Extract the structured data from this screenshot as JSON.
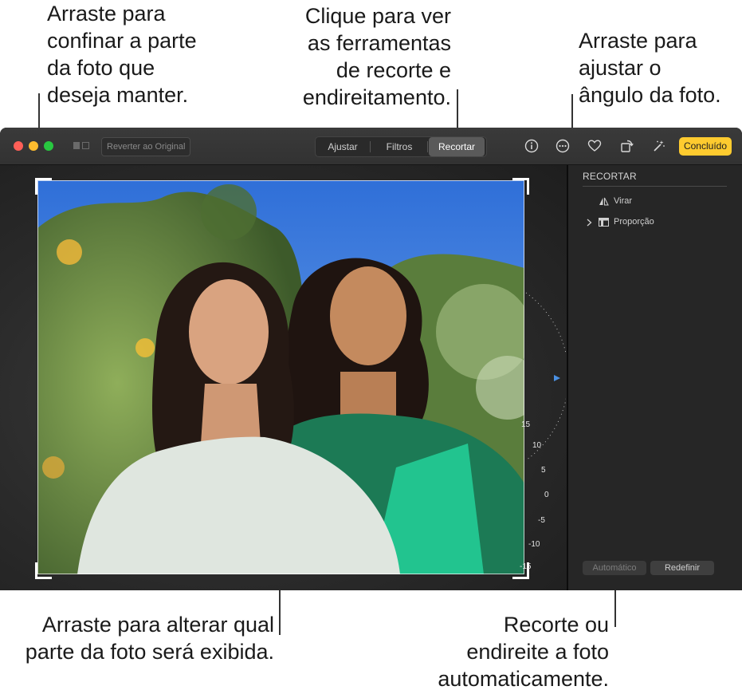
{
  "callouts": {
    "crop_frame": "Arraste para\nconfinar a parte\nda foto que\ndeseja manter.",
    "crop_tab": "Clique para ver\nas ferramentas\nde recorte e\nendireitamento.",
    "angle": "Arraste para\najustar o\nângulo da foto.",
    "drag_photo": "Arraste para alterar qual\nparte da foto será exibida.",
    "auto": "Recorte ou\nendireite a foto\nautomaticamente."
  },
  "toolbar": {
    "revert_label": "Reverter ao Original",
    "tabs": [
      {
        "label": "Ajustar",
        "selected": false
      },
      {
        "label": "Filtros",
        "selected": false
      },
      {
        "label": "Recortar",
        "selected": true
      }
    ],
    "icons": [
      "info-icon",
      "more-icon",
      "heart-icon",
      "rotate-icon",
      "enhance-icon"
    ],
    "done_label": "Concluído",
    "done_color": "#fecb2f"
  },
  "dial": {
    "labels": [
      "15",
      "10",
      "5",
      "0",
      "-5",
      "-10",
      "-15"
    ],
    "current": "0"
  },
  "sidebar": {
    "title": "RECORTAR",
    "items": [
      {
        "label": "Virar",
        "icon": "flip-icon"
      },
      {
        "label": "Proporção",
        "icon": "aspect-icon"
      }
    ],
    "auto_label": "Automático",
    "reset_label": "Redefinir"
  }
}
